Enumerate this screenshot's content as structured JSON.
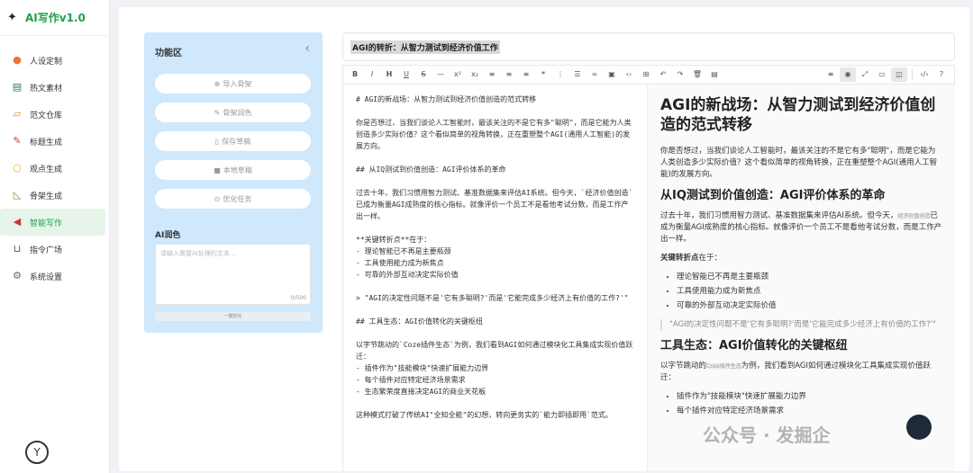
{
  "app": {
    "title": "AI写作v1.0"
  },
  "sidebar": {
    "items": [
      {
        "label": "人设定制",
        "icon": "fire-icon"
      },
      {
        "label": "热文素材",
        "icon": "book-icon"
      },
      {
        "label": "范文仓库",
        "icon": "slides-icon"
      },
      {
        "label": "标题生成",
        "icon": "pin-icon"
      },
      {
        "label": "观点生成",
        "icon": "bulb-icon"
      },
      {
        "label": "骨架生成",
        "icon": "ruler-icon"
      },
      {
        "label": "智能写作",
        "icon": "megaphone-icon",
        "active": true
      },
      {
        "label": "指令广场",
        "icon": "cart-icon"
      },
      {
        "label": "系统设置",
        "icon": "gear-icon"
      }
    ]
  },
  "function_panel": {
    "title": "功能区",
    "buttons": [
      {
        "label": "导入骨架",
        "icon": "plus-circle-icon"
      },
      {
        "label": "骨架润色",
        "icon": "pencil-icon"
      },
      {
        "label": "保存草稿",
        "icon": "bookmark-icon"
      },
      {
        "label": "本地草稿",
        "icon": "folder-icon"
      },
      {
        "label": "优化任务",
        "icon": "check-circle-icon"
      }
    ],
    "ai_title": "AI润色",
    "ai_placeholder": "请输入需要AI处理的文本...",
    "ai_count": "0/500",
    "ai_button": "一键优化"
  },
  "editor": {
    "title": "AGI的转折：从智力测试到经济价值工作",
    "source": [
      "# AGI的新战场：从智力测试到经济价值创造的范式转移",
      "你是否想过，当我们谈论人工智能时，最该关注的不是它有多\"聪明\"，而是它能为人类创造多少实际价值？这个看似简单的视角转换，正在重塑整个AGI(通用人工智能)的发展方向。",
      "## 从IQ测试到价值创造：AGI评价体系的革命",
      "过去十年，我们习惯用智力测试、基准数据集来评估AI系统。但今天，`经济价值创造`已成为衡量AGI成熟度的核心指标。就像评价一个员工不是看他考试分数，而是工作产出一样。",
      "**关键转折点**在于：\n- 理论智能已不再是主要瓶颈\n- 工具使用能力成为新焦点\n- 可靠的外部互动决定实际价值",
      "> \"AGI的决定性问题不是'它有多聪明?'而是'它能完成多少经济上有价值的工作?'\"",
      "## 工具生态：AGI价值转化的关键枢纽",
      "以字节跳动的`Coze插件生态`为例，我们看到AGI如何通过模块化工具集成实现价值跃迁：\n- 插件作为\"技能模块\"快速扩展能力边界\n- 每个插件对应特定经济场景需求\n- 生态繁荣度直接决定AGI的商业天花板",
      "这种模式打破了传统AI\"全知全能\"的幻想，转向更务实的`能力即插即用`范式。"
    ],
    "preview": {
      "h1": "AGI的新战场：从智力测试到经济价值创造的范式转移",
      "p1": "你是否想过，当我们谈论人工智能时，最该关注的不是它有多\"聪明\"，而是它能为人类创造多少实际价值？这个看似简单的视角转换，正在重塑整个AGI(通用人工智能)的发展方向。",
      "h2a": "从IQ测试到价值创造：AGI评价体系的革命",
      "p2_before": "过去十年，我们习惯用智力测试、基准数据集来评估AI系统。但今天，",
      "p2_code": "经济价值创造",
      "p2_after": "已成为衡量AGI成熟度的核心指标。就像评价一个员工不是看他考试分数，而是工作产出一样。",
      "p3_bold": "关键转折点",
      "p3_rest": "在于：",
      "list1": [
        "理论智能已不再是主要瓶颈",
        "工具使用能力成为新焦点",
        "可靠的外部互动决定实际价值"
      ],
      "quote": "\"AGI的决定性问题不是'它有多聪明?'而是'它能完成多少经济上有价值的工作?'\"",
      "h2b": "工具生态：AGI价值转化的关键枢纽",
      "p4_before": "以字节跳动的",
      "p4_code": "Coze插件生态",
      "p4_after": "为例，我们看到AGI如何通过模块化工具集成实现价值跃迁：",
      "list2": [
        "插件作为\"技能模块\"快速扩展能力边界",
        "每个插件对应特定经济场景需求"
      ]
    }
  },
  "watermark": "公众号 · 发掘企"
}
